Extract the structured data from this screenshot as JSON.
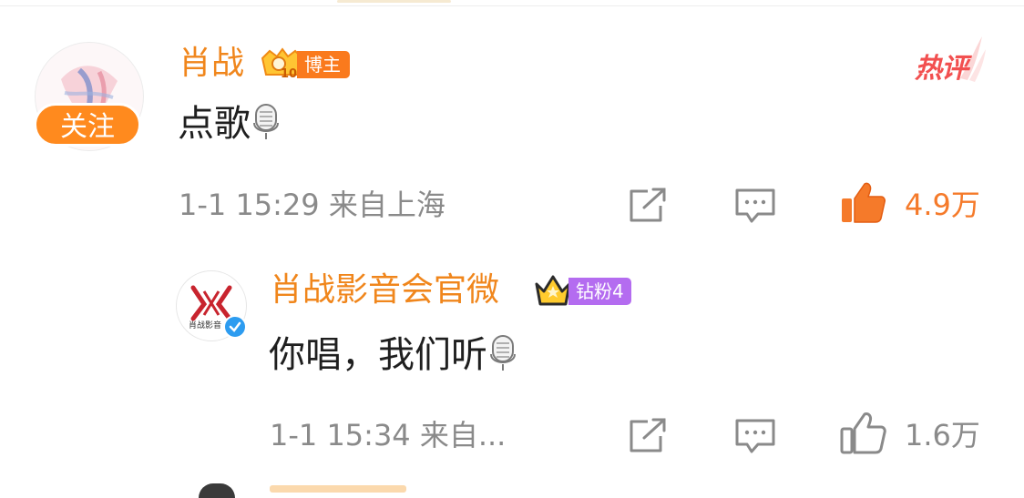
{
  "comment": {
    "username": "肖战",
    "vip_level": "10",
    "role_tag": "博主",
    "hot_label": "热评",
    "follow_label": "关注",
    "content": "点歌",
    "date": "1-1 15:29",
    "location": "来自上海",
    "likes": "4.9万",
    "liked": true
  },
  "reply": {
    "username": "肖战影音会官微",
    "fan_tag": "钻粉4",
    "avatar_text": "肖战影音",
    "content": "你唱，我们听",
    "date": "1-1 15:34",
    "location": "来自...",
    "likes": "1.6万",
    "liked": false
  },
  "icons": {
    "share": "share-external-icon",
    "comment": "comment-bubble-icon",
    "like": "thumbs-up-icon",
    "mic": "microphone-emoji-icon"
  },
  "colors": {
    "username": "#f0861c",
    "follow": "#ff8a1e",
    "hot": "#f25050",
    "fan_tag": "#b46cf0",
    "like_active": "#f57a2a",
    "meta": "#8a8a8a"
  }
}
